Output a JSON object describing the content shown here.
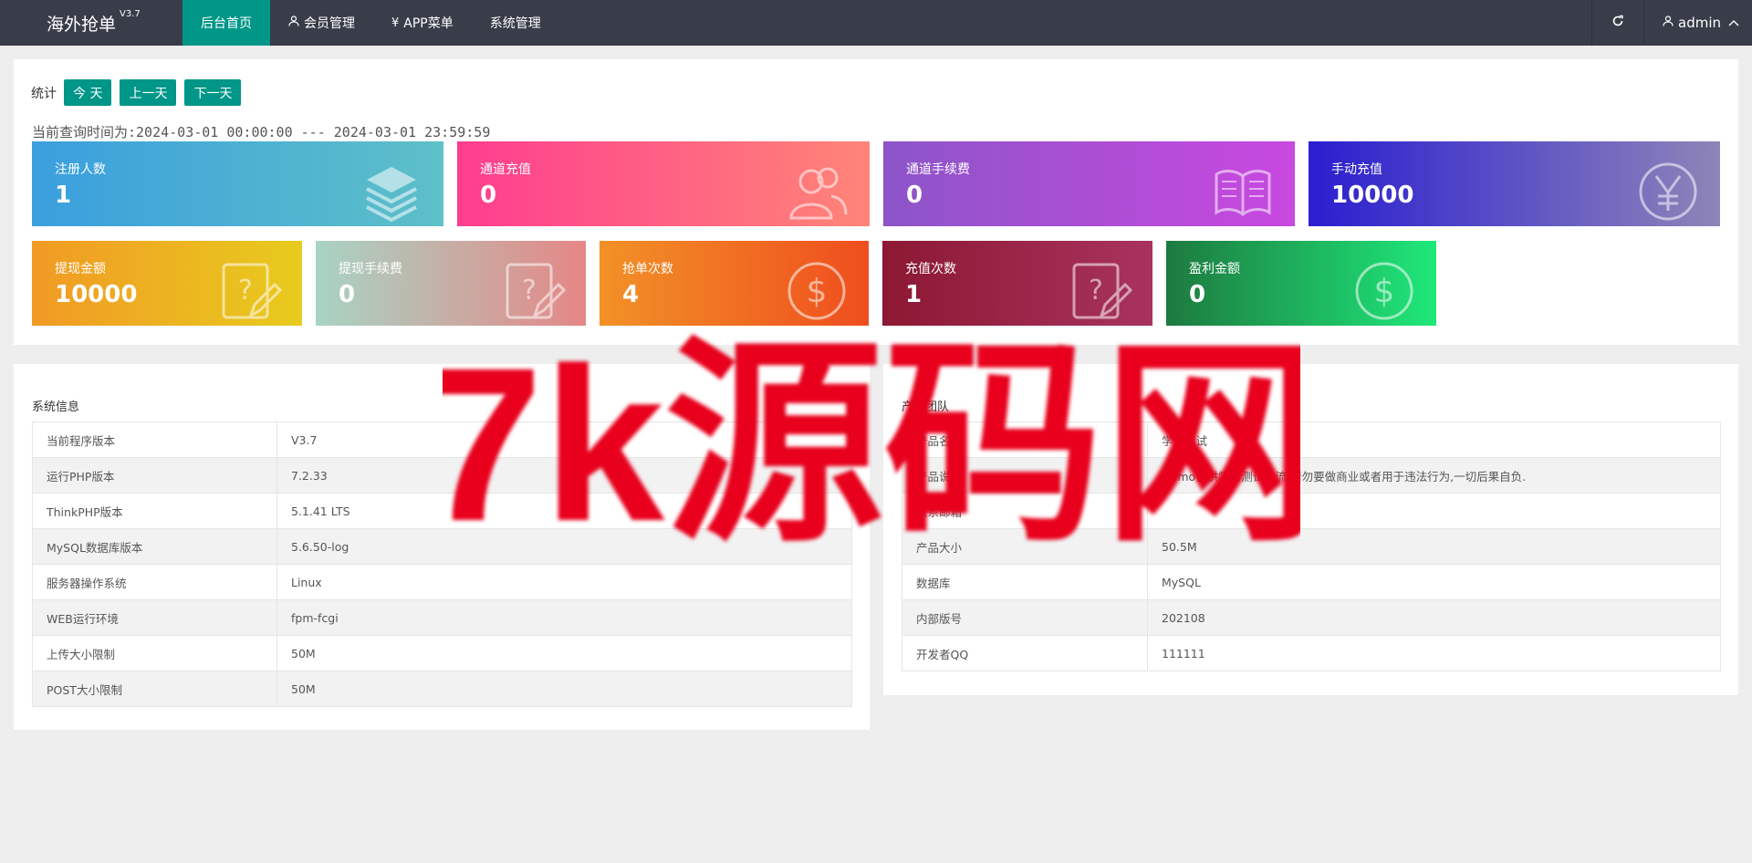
{
  "topbar": {
    "brand": "海外抢单",
    "version": "V3.7",
    "nav": [
      {
        "label": "后台首页",
        "icon": "",
        "active": true
      },
      {
        "label": "会员管理",
        "icon": "user-icon"
      },
      {
        "label": "APP菜单",
        "icon": "yen-icon"
      },
      {
        "label": "系统管理",
        "icon": ""
      }
    ],
    "user": "admin"
  },
  "stats": {
    "label": "统计",
    "buttons": {
      "today": "今 天",
      "prev": "上一天",
      "next": "下一天"
    },
    "range": "当前查询时间为:2024-03-01 00:00:00 --- 2024-03-01 23:59:59",
    "cards": [
      {
        "title": "注册人数",
        "value": "1",
        "icon": "layers-icon",
        "colors": [
          "#3a9fde",
          "#5ec0c8"
        ]
      },
      {
        "title": "通道充值",
        "value": "0",
        "icon": "users-icon",
        "colors": [
          "#ff3d8f",
          "#ff8577"
        ]
      },
      {
        "title": "通道手续费",
        "value": "0",
        "icon": "book-icon",
        "colors": [
          "#8c55c8",
          "#c948e0"
        ]
      },
      {
        "title": "手动充值",
        "value": "10000",
        "icon": "yen-circle-icon",
        "colors": [
          "#2a1ed0",
          "#8e85b8"
        ]
      },
      {
        "title": "提现金额",
        "value": "10000",
        "icon": "question-edit-icon",
        "colors": [
          "#f19a24",
          "#e8cb1e"
        ]
      },
      {
        "title": "提现手续费",
        "value": "0",
        "icon": "question-edit-icon",
        "colors": [
          "#a8d4c4",
          "#e58786"
        ]
      },
      {
        "title": "抢单次数",
        "value": "4",
        "icon": "dollar-circle-icon",
        "colors": [
          "#f29127",
          "#ef4e1e"
        ]
      },
      {
        "title": "充值次数",
        "value": "1",
        "icon": "question-edit-icon",
        "colors": [
          "#8c1833",
          "#a8335e"
        ]
      },
      {
        "title": "盈利金额",
        "value": "0",
        "icon": "dollar-circle-icon",
        "colors": [
          "#1d7a3f",
          "#1fe87a"
        ]
      }
    ]
  },
  "system": {
    "title": "系统信息",
    "rows": [
      [
        "当前程序版本",
        "V3.7"
      ],
      [
        "运行PHP版本",
        "7.2.33"
      ],
      [
        "ThinkPHP版本",
        "5.1.41 LTS"
      ],
      [
        "MySQL数据库版本",
        "5.6.50-log"
      ],
      [
        "服务器操作系统",
        "Linux"
      ],
      [
        "WEB运行环境",
        "fpm-fcgi"
      ],
      [
        "上传大小限制",
        "50M"
      ],
      [
        "POST大小限制",
        "50M"
      ]
    ]
  },
  "product": {
    "title": "产品团队",
    "rows": [
      [
        "产品名称",
        "学习测试"
      ],
      [
        "产品说明",
        "Demo仅供学习测试交流,请勿要做商业或者用于违法行为,一切后果自负."
      ],
      [
        "联系邮箱",
        ""
      ],
      [
        "产品大小",
        "50.5M"
      ],
      [
        "数据库",
        "MySQL"
      ],
      [
        "内部版号",
        "202108"
      ],
      [
        "开发者QQ",
        "111111"
      ]
    ]
  },
  "watermark": "7k源码网"
}
